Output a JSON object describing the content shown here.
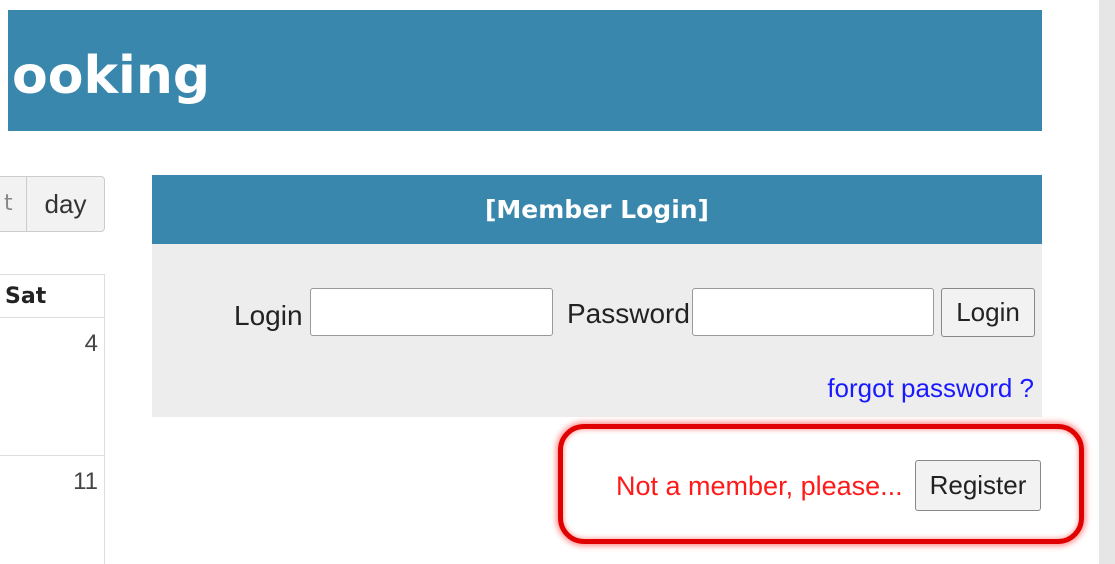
{
  "header": {
    "title": "ooking"
  },
  "calendar": {
    "partial_view_button": "t",
    "day_button": "day",
    "column_header": "Sat",
    "dates": [
      "4",
      "11"
    ]
  },
  "login": {
    "panel_title": "[Member Login]",
    "login_label": "Login",
    "login_value": "",
    "password_label": "Password",
    "password_value": "",
    "submit_label": "Login",
    "forgot_link": "forgot password ?"
  },
  "register": {
    "prompt": "Not a member, please...",
    "button_label": "Register"
  },
  "colors": {
    "header_blue": "#3a87ad",
    "panel_gray": "#ededed",
    "link_blue": "#1a1aff",
    "alert_red": "#ff1a1a",
    "highlight_red": "#e00000"
  }
}
